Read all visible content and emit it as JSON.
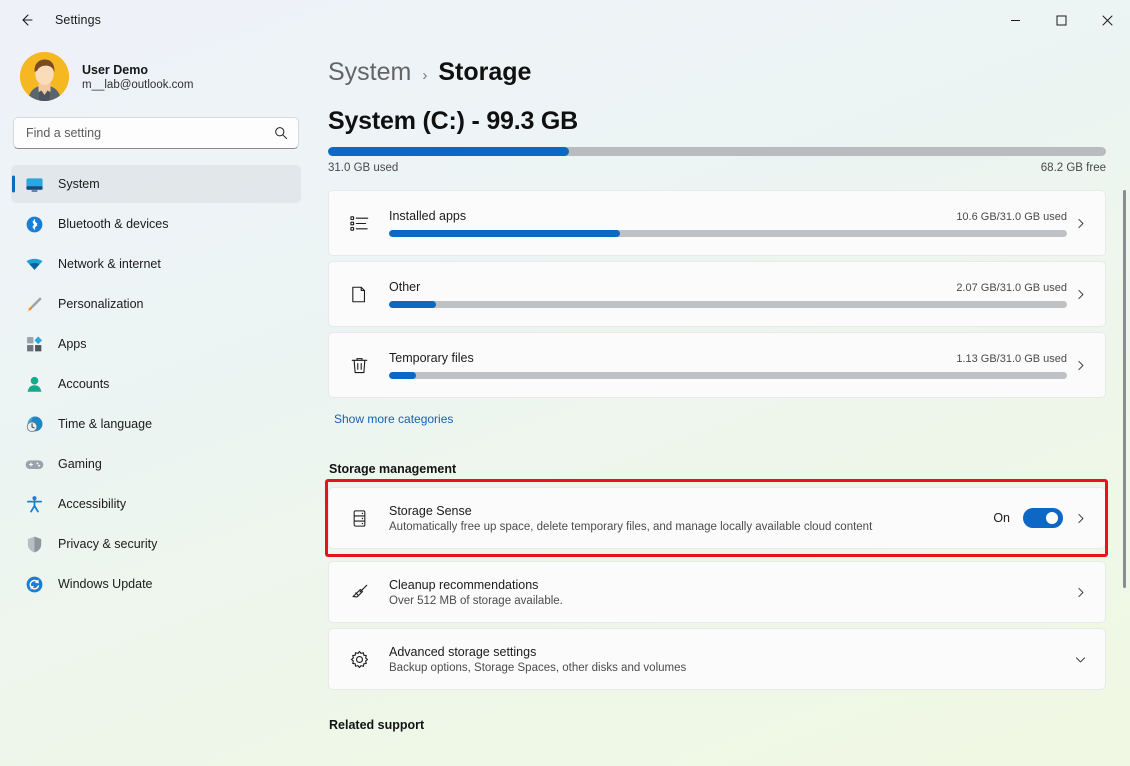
{
  "window": {
    "app_title": "Settings",
    "back_icon": "back-arrow-icon",
    "minimize_label": "Minimize",
    "maximize_label": "Maximize",
    "close_label": "Close"
  },
  "sidebar": {
    "account": {
      "name": "User Demo",
      "email": "m__lab@outlook.com",
      "avatar_bg": "#f5b820"
    },
    "search": {
      "placeholder": "Find a setting",
      "icon": "search-icon"
    },
    "items": [
      {
        "label": "System",
        "icon": "monitor-icon",
        "active": true
      },
      {
        "label": "Bluetooth & devices",
        "icon": "bluetooth-icon",
        "active": false
      },
      {
        "label": "Network & internet",
        "icon": "wifi-icon",
        "active": false
      },
      {
        "label": "Personalization",
        "icon": "paintbrush-icon",
        "active": false
      },
      {
        "label": "Apps",
        "icon": "apps-grid-icon",
        "active": false
      },
      {
        "label": "Accounts",
        "icon": "person-icon",
        "active": false
      },
      {
        "label": "Time & language",
        "icon": "clock-globe-icon",
        "active": false
      },
      {
        "label": "Gaming",
        "icon": "gamepad-icon",
        "active": false
      },
      {
        "label": "Accessibility",
        "icon": "accessibility-icon",
        "active": false
      },
      {
        "label": "Privacy & security",
        "icon": "shield-icon",
        "active": false
      },
      {
        "label": "Windows Update",
        "icon": "update-refresh-icon",
        "active": false
      }
    ]
  },
  "main": {
    "breadcrumb": {
      "parent": "System",
      "separator": "›",
      "current": "Storage"
    },
    "drive": {
      "title": "System (C:) - 99.3 GB",
      "used_percent": 31,
      "used_label": "31.0 GB used",
      "free_label": "68.2 GB free"
    },
    "categories": [
      {
        "name": "Installed apps",
        "used": "10.6 GB/31.0 GB used",
        "percent": 34,
        "icon": "list-icon"
      },
      {
        "name": "Other",
        "used": "2.07 GB/31.0 GB used",
        "percent": 7,
        "icon": "documents-icon"
      },
      {
        "name": "Temporary files",
        "used": "1.13 GB/31.0 GB used",
        "percent": 4,
        "icon": "trash-icon"
      }
    ],
    "show_more": "Show more categories",
    "management_heading": "Storage management",
    "storage_sense": {
      "title": "Storage Sense",
      "subtitle": "Automatically free up space, delete temporary files, and manage locally available cloud content",
      "toggle_state": "On",
      "toggle_on": true,
      "icon": "drive-stack-icon",
      "highlight_color": "#e81123"
    },
    "cleanup": {
      "title": "Cleanup recommendations",
      "subtitle": "Over 512 MB of storage available.",
      "icon": "broom-icon"
    },
    "advanced": {
      "title": "Advanced storage settings",
      "subtitle": "Backup options, Storage Spaces, other disks and volumes",
      "icon": "gear-icon"
    },
    "related_support": "Related support"
  }
}
